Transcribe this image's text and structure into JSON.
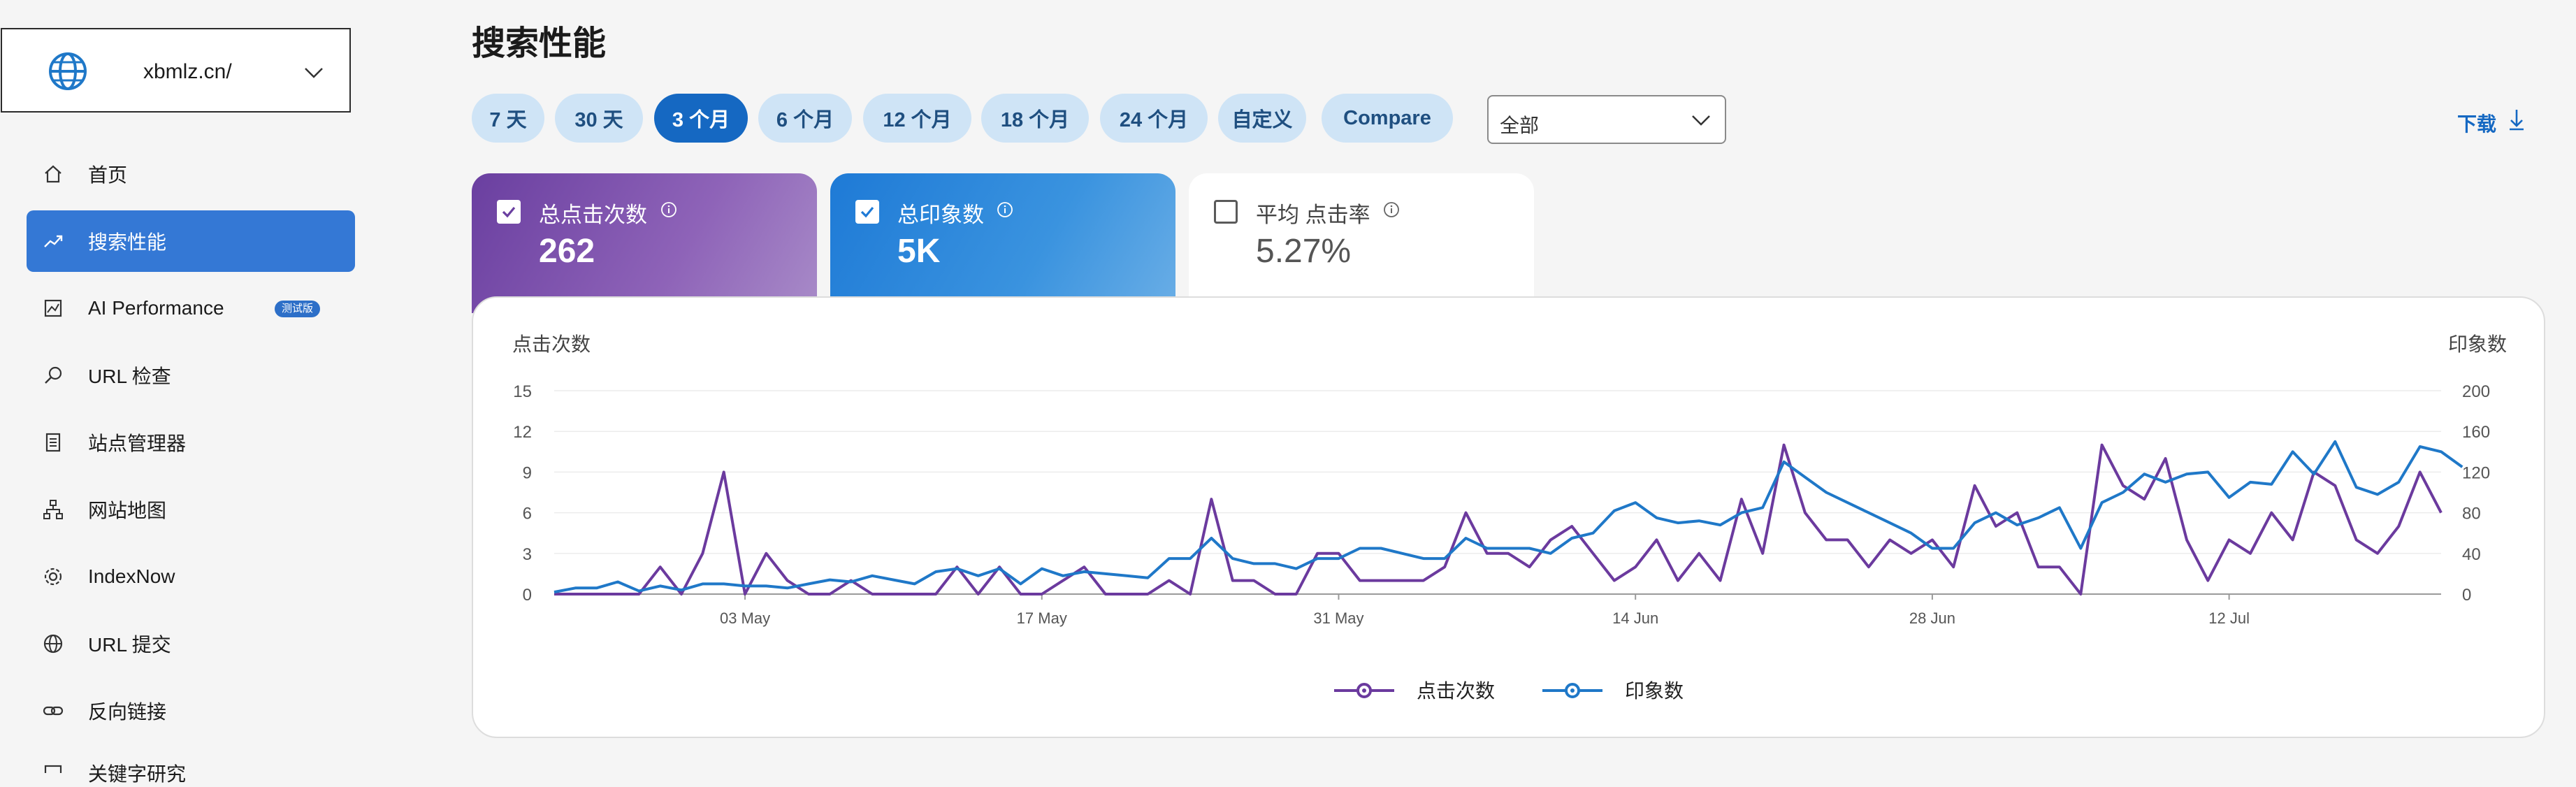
{
  "site_selector": {
    "value": "xbmlz.cn/"
  },
  "nav": [
    {
      "label": "首页",
      "icon": "home-icon"
    },
    {
      "label": "搜索性能",
      "icon": "trending-up-icon",
      "active": true
    },
    {
      "label": "AI Performance",
      "icon": "image-chart-icon",
      "badge": "测试版"
    },
    {
      "label": "URL 检查",
      "icon": "search-icon"
    },
    {
      "label": "站点管理器",
      "icon": "document-list-icon"
    },
    {
      "label": "网站地图",
      "icon": "sitemap-icon"
    },
    {
      "label": "IndexNow",
      "icon": "gear-icon"
    },
    {
      "label": "URL 提交",
      "icon": "globe-icon"
    },
    {
      "label": "反向链接",
      "icon": "link-icon"
    },
    {
      "label": "关键字研究",
      "icon": "keyword-icon"
    }
  ],
  "header": {
    "title": "搜索性能",
    "ranges": [
      "7 天",
      "30 天",
      "3 个月",
      "6 个月",
      "12 个月",
      "18 个月",
      "24 个月",
      "自定义",
      "Compare"
    ],
    "active_range": "3 个月",
    "filter_value": "全部",
    "download_label": "下载"
  },
  "metrics": [
    {
      "label": "总点击次数",
      "value": "262",
      "checked": true,
      "color": "#6a3fa0"
    },
    {
      "label": "总印象数",
      "value": "5K",
      "checked": true,
      "color": "#1e7ad6"
    },
    {
      "label": "平均 点击率",
      "value": "5.27%",
      "checked": false,
      "color": "#ffffff"
    }
  ],
  "chart_data": {
    "type": "line",
    "left_axis_title": "点击次数",
    "right_axis_title": "印象数",
    "y_left": {
      "ticks": [
        0,
        3,
        6,
        9,
        12,
        15
      ],
      "range": [
        0,
        15
      ]
    },
    "y_right": {
      "ticks": [
        0,
        40,
        80,
        120,
        160,
        200
      ],
      "range": [
        0,
        200
      ]
    },
    "x_tick_labels": [
      "03 May",
      "17 May",
      "31 May",
      "14 Jun",
      "28 Jun",
      "12 Jul"
    ],
    "x_tick_index": [
      9,
      23,
      37,
      51,
      65,
      79
    ],
    "legend": [
      "点击次数",
      "印象数"
    ],
    "series": [
      {
        "name": "点击次数",
        "axis": "left",
        "color": "#6b3a9e",
        "values": [
          0,
          0,
          0,
          0,
          0,
          2,
          0,
          3,
          9,
          0,
          3,
          1,
          0,
          0,
          1,
          0,
          0,
          0,
          0,
          2,
          0,
          2,
          0,
          0,
          1,
          2,
          0,
          0,
          0,
          1,
          0,
          7,
          1,
          1,
          0,
          0,
          3,
          3,
          1,
          1,
          1,
          1,
          2,
          6,
          3,
          3,
          2,
          4,
          5,
          3,
          1,
          2,
          4,
          1,
          3,
          1,
          7,
          3,
          11,
          6,
          4,
          4,
          2,
          4,
          3,
          4,
          2,
          8,
          5,
          6,
          2,
          2,
          0,
          11,
          8,
          7,
          10,
          4,
          1,
          4,
          3,
          6,
          4,
          9,
          8,
          4,
          3,
          5,
          9,
          6
        ]
      },
      {
        "name": "印象数",
        "axis": "right",
        "color": "#1f78c8",
        "values": [
          2,
          6,
          6,
          12,
          3,
          8,
          4,
          10,
          10,
          8,
          8,
          6,
          10,
          14,
          12,
          18,
          14,
          10,
          22,
          25,
          18,
          25,
          10,
          25,
          18,
          22,
          20,
          18,
          16,
          35,
          35,
          55,
          35,
          30,
          30,
          25,
          35,
          35,
          45,
          45,
          40,
          35,
          35,
          55,
          45,
          45,
          45,
          40,
          55,
          60,
          82,
          90,
          75,
          70,
          72,
          68,
          80,
          85,
          130,
          115,
          100,
          90,
          80,
          70,
          60,
          45,
          45,
          70,
          80,
          68,
          75,
          85,
          45,
          90,
          100,
          118,
          110,
          118,
          120,
          95,
          110,
          108,
          140,
          118,
          150,
          105,
          98,
          110,
          145,
          140,
          125
        ]
      }
    ]
  },
  "partial_item": "关键字研究"
}
